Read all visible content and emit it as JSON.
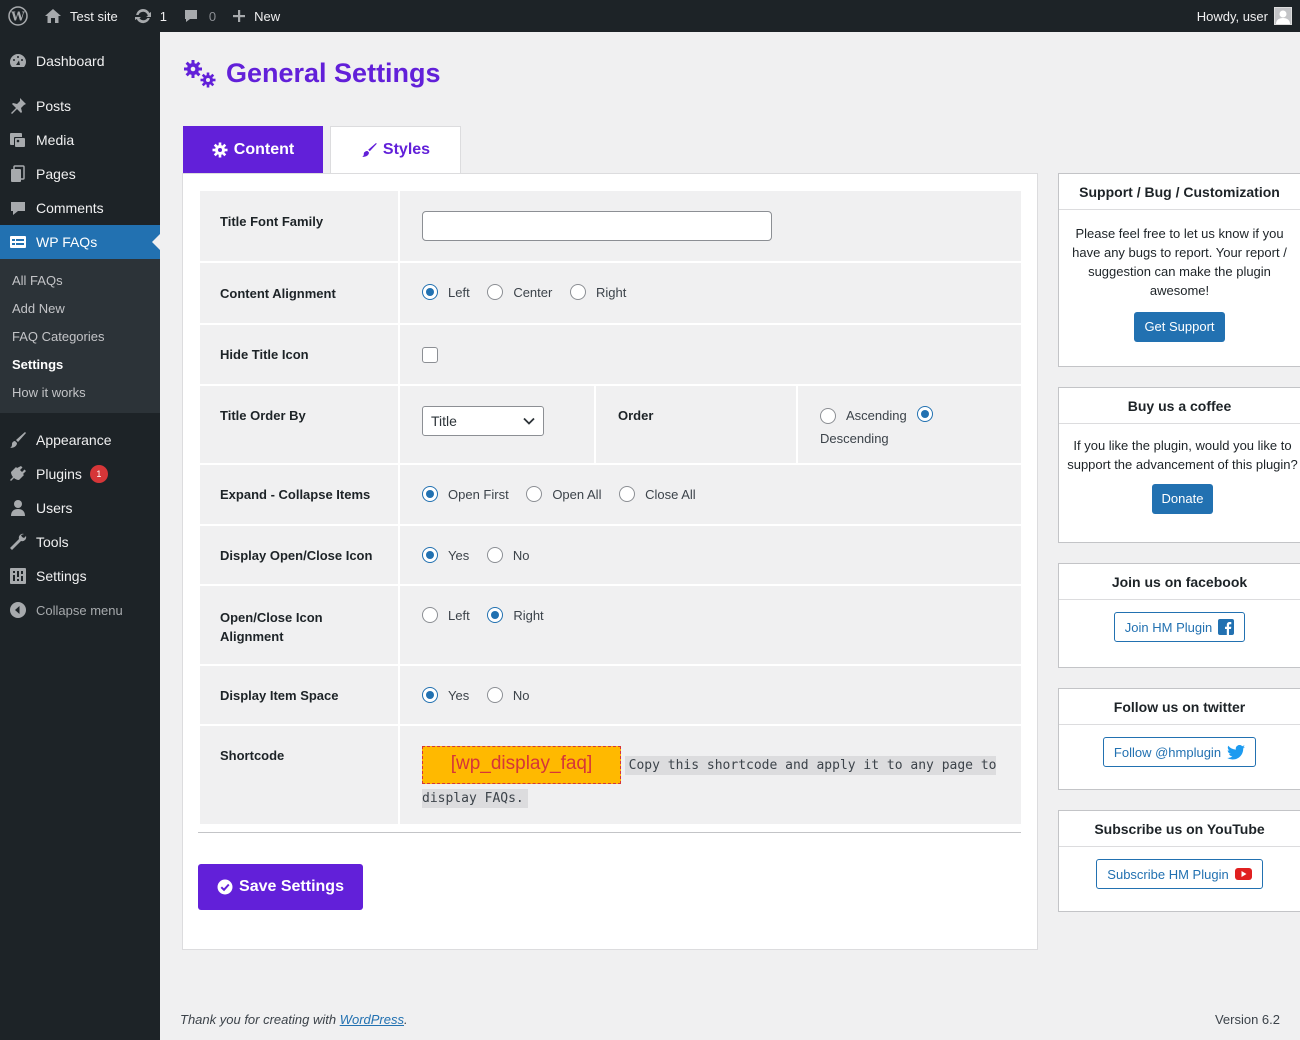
{
  "adminbar": {
    "site_name": "Test site",
    "updates_count": "1",
    "comments_count": "0",
    "new_label": "New",
    "howdy": "Howdy, user"
  },
  "sidebar": {
    "items": [
      {
        "label": "Dashboard",
        "icon": "dashboard-icon"
      },
      {
        "label": "Posts",
        "icon": "pin-icon"
      },
      {
        "label": "Media",
        "icon": "media-icon"
      },
      {
        "label": "Pages",
        "icon": "pages-icon"
      },
      {
        "label": "Comments",
        "icon": "comments-icon"
      },
      {
        "label": "WP FAQs",
        "icon": "faq-icon"
      },
      {
        "label": "Appearance",
        "icon": "brush-icon"
      },
      {
        "label": "Plugins",
        "icon": "plugin-icon",
        "badge": "1"
      },
      {
        "label": "Users",
        "icon": "user-icon"
      },
      {
        "label": "Tools",
        "icon": "wrench-icon"
      },
      {
        "label": "Settings",
        "icon": "settings-icon"
      }
    ],
    "submenu": [
      "All FAQs",
      "Add New",
      "FAQ Categories",
      "Settings",
      "How it works"
    ],
    "collapse_label": "Collapse menu"
  },
  "page": {
    "title": "General Settings",
    "tabs": {
      "content": "Content",
      "styles": "Styles"
    }
  },
  "form": {
    "title_font_family": {
      "label": "Title Font Family",
      "value": ""
    },
    "content_alignment": {
      "label": "Content Alignment",
      "options": [
        "Left",
        "Center",
        "Right"
      ],
      "selected": "Left"
    },
    "hide_title_icon": {
      "label": "Hide Title Icon",
      "checked": false
    },
    "title_order_by": {
      "label": "Title Order By",
      "value": "Title",
      "order_label": "Order",
      "order_options": [
        "Ascending",
        "Descending"
      ],
      "order_selected": "Descending"
    },
    "expand_collapse": {
      "label": "Expand - Collapse Items",
      "options": [
        "Open First",
        "Open All",
        "Close All"
      ],
      "selected": "Open First"
    },
    "display_icon": {
      "label": "Display Open/Close Icon",
      "options": [
        "Yes",
        "No"
      ],
      "selected": "Yes"
    },
    "icon_alignment": {
      "label": "Open/Close Icon Alignment",
      "options": [
        "Left",
        "Right"
      ],
      "selected": "Right"
    },
    "item_space": {
      "label": "Display Item Space",
      "options": [
        "Yes",
        "No"
      ],
      "selected": "Yes"
    },
    "shortcode": {
      "label": "Shortcode",
      "code": "[wp_display_faq]",
      "note": "Copy this shortcode and apply it to any page to display FAQs."
    },
    "save_label": "Save Settings"
  },
  "widgets": {
    "support": {
      "title": "Support / Bug / Customization",
      "text": "Please feel free to let us know if you have any bugs to report. Your report / suggestion can make the plugin awesome!",
      "button": "Get Support"
    },
    "coffee": {
      "title": "Buy us a coffee",
      "text": "If you like the plugin, would you like to support the advancement of this plugin?",
      "button": "Donate"
    },
    "facebook": {
      "title": "Join us on facebook",
      "button": "Join HM Plugin"
    },
    "twitter": {
      "title": "Follow us on twitter",
      "button": "Follow @hmplugin"
    },
    "youtube": {
      "title": "Subscribe us on YouTube",
      "button": "Subscribe HM Plugin"
    }
  },
  "footer": {
    "thanks_prefix": "Thank you for creating with ",
    "thanks_link": "WordPress",
    "thanks_suffix": ".",
    "version": "Version 6.2"
  },
  "colors": {
    "accent": "#6220d9",
    "wp_blue": "#2271b1",
    "shortcode_bg": "#ffb900",
    "shortcode_text": "#d63638"
  }
}
